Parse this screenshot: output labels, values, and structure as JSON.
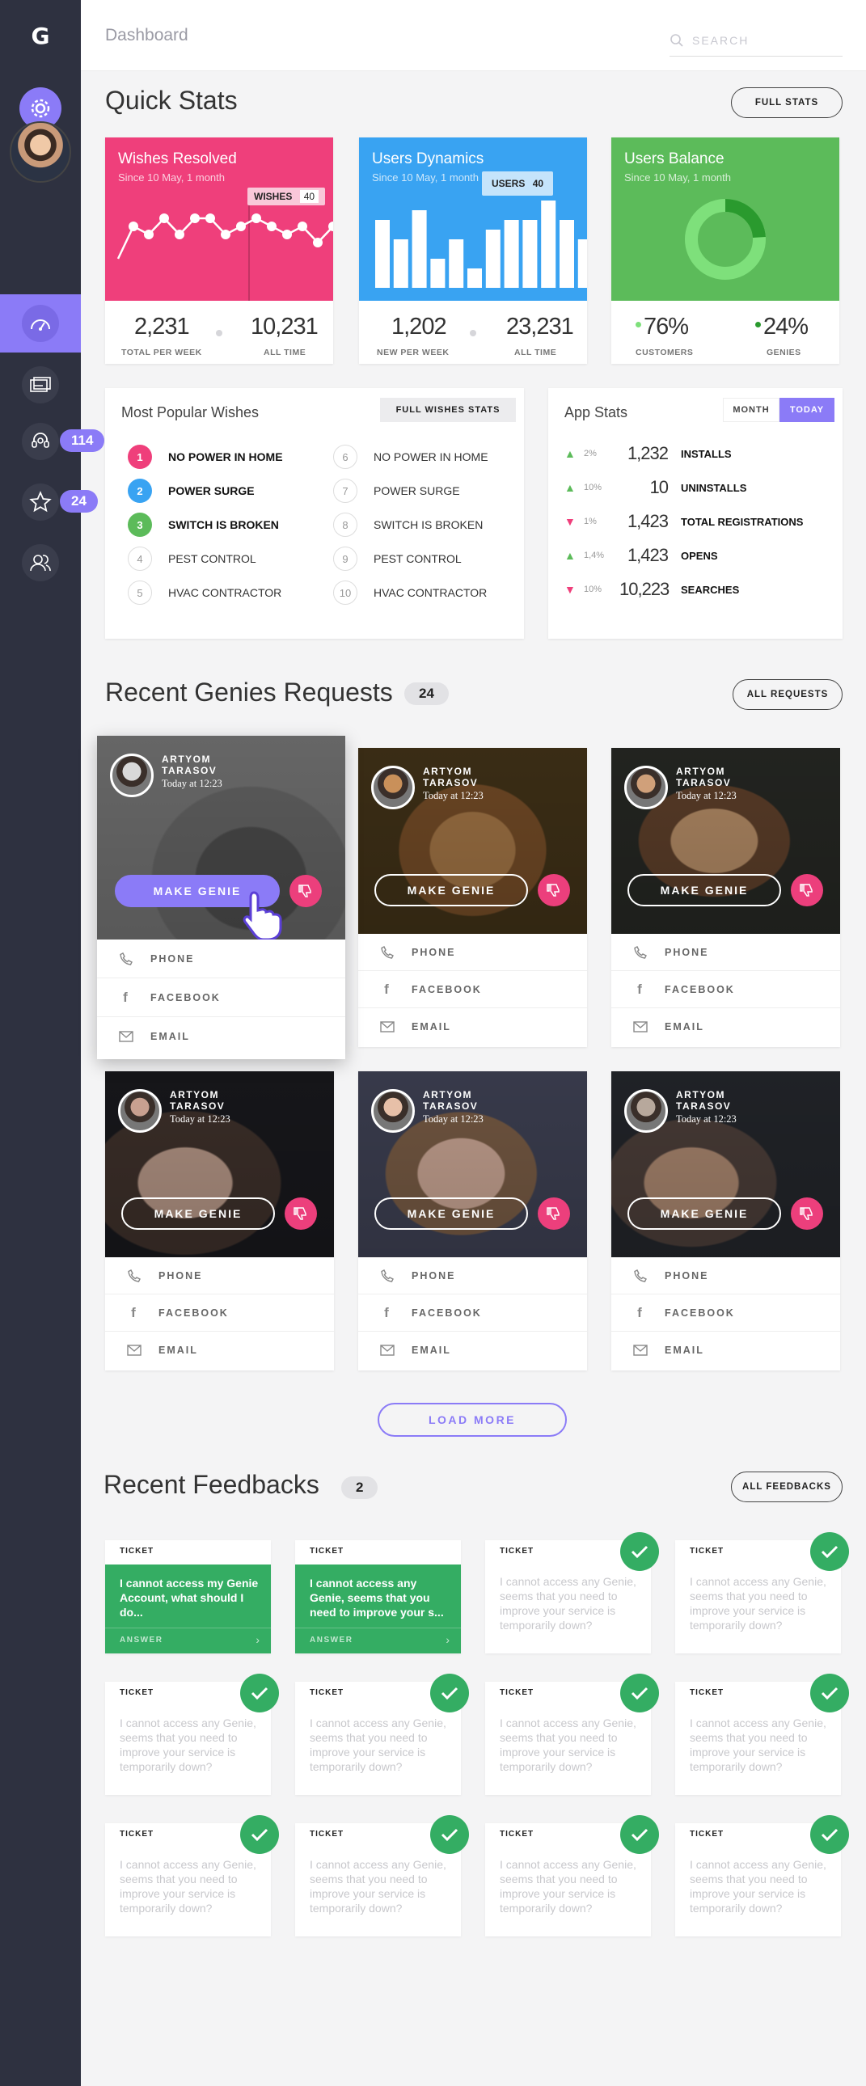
{
  "app": {
    "logo": "G",
    "breadcrumb": "Dashboard"
  },
  "search": {
    "placeholder": "SEARCH"
  },
  "sidebar": {
    "items": [
      {
        "name": "dashboard",
        "icon": "gauge-icon",
        "active": true
      },
      {
        "name": "cards",
        "icon": "cards-icon"
      },
      {
        "name": "support",
        "icon": "headset-icon",
        "badge": "114"
      },
      {
        "name": "favorites",
        "icon": "star-icon",
        "badge": "24"
      },
      {
        "name": "users",
        "icon": "users-icon"
      }
    ]
  },
  "quick_stats": {
    "title": "Quick Stats",
    "full_stats_label": "FULL STATS",
    "cards": [
      {
        "title": "Wishes Resolved",
        "subtitle": "Since 10 May, 1 month",
        "color": "#ef3f7b",
        "tooltip_label": "WISHES",
        "tooltip_value": "40",
        "v1": "2,231",
        "l1": "TOTAL PER WEEK",
        "v2": "10,231",
        "l2": "ALL TIME"
      },
      {
        "title": "Users Dynamics",
        "subtitle": "Since 10 May, 1 month",
        "color": "#39a3f2",
        "tooltip_label": "USERS",
        "tooltip_value": "40",
        "v1": "1,202",
        "l1": "NEW PER WEEK",
        "v2": "23,231",
        "l2": "ALL TIME"
      },
      {
        "title": "Users Balance",
        "subtitle": "Since 10 May, 1 month",
        "color": "#5cbb5a",
        "v1": "76%",
        "l1": "CUSTOMERS",
        "v2": "24%",
        "l2": "GENIES"
      }
    ]
  },
  "chart_data": [
    {
      "type": "line",
      "values": [
        2,
        6,
        5,
        7,
        5,
        7,
        7,
        5,
        6,
        7,
        6,
        5,
        6,
        4,
        6
      ],
      "tooltip": "WISHES 40"
    },
    {
      "type": "bar",
      "values": [
        7,
        5,
        8,
        3,
        5,
        2,
        6,
        7,
        7,
        9,
        7,
        5
      ],
      "tooltip": "USERS 40"
    },
    {
      "type": "pie",
      "slices": [
        {
          "name": "CUSTOMERS",
          "value": 76
        },
        {
          "name": "GENIES",
          "value": 24
        }
      ]
    }
  ],
  "popular_wishes": {
    "title": "Most Popular Wishes",
    "button": "FULL WISHES STATS",
    "left": [
      {
        "n": "1",
        "label": "NO POWER IN HOME",
        "color": "#ef3f7b"
      },
      {
        "n": "2",
        "label": "POWER SURGE",
        "color": "#39a3f2"
      },
      {
        "n": "3",
        "label": "SWITCH IS BROKEN",
        "color": "#5cbb5a"
      },
      {
        "n": "4",
        "label": "PEST CONTROL"
      },
      {
        "n": "5",
        "label": "HVAC CONTRACTOR"
      }
    ],
    "right": [
      {
        "n": "6",
        "label": "NO POWER IN HOME"
      },
      {
        "n": "7",
        "label": "POWER SURGE"
      },
      {
        "n": "8",
        "label": "SWITCH IS BROKEN"
      },
      {
        "n": "9",
        "label": "PEST CONTROL"
      },
      {
        "n": "10",
        "label": "HVAC CONTRACTOR"
      }
    ]
  },
  "app_stats": {
    "title": "App Stats",
    "tab_month": "MONTH",
    "tab_today": "TODAY",
    "rows": [
      {
        "trend": "up",
        "pct": "2%",
        "value": "1,232",
        "label": "INSTALLS"
      },
      {
        "trend": "up",
        "pct": "10%",
        "value": "10",
        "label": "UNINSTALLS"
      },
      {
        "trend": "down",
        "pct": "1%",
        "value": "1,423",
        "label": "TOTAL REGISTRATIONS"
      },
      {
        "trend": "up",
        "pct": "1,4%",
        "value": "1,423",
        "label": "OPENS"
      },
      {
        "trend": "down",
        "pct": "10%",
        "value": "10,223",
        "label": "SEARCHES"
      }
    ]
  },
  "requests": {
    "title": "Recent Genies Requests",
    "count": "24",
    "all_label": "ALL REQUESTS",
    "make_label": "MAKE GENIE",
    "phone_label": "PHONE",
    "facebook_label": "FACEBOOK",
    "email_label": "EMAIL",
    "cards": [
      {
        "name": "ARTYOM TARASOV",
        "time": "Today at 12:23"
      },
      {
        "name": "ARTYOM TARASOV",
        "time": "Today at 12:23"
      },
      {
        "name": "ARTYOM TARASOV",
        "time": "Today at 12:23"
      },
      {
        "name": "ARTYOM TARASOV",
        "time": "Today at 12:23"
      },
      {
        "name": "ARTYOM TARASOV",
        "time": "Today at 12:23"
      },
      {
        "name": "ARTYOM TARASOV",
        "time": "Today at 12:23"
      }
    ],
    "load_more": "LOAD MORE"
  },
  "feedbacks": {
    "title": "Recent Feedbacks",
    "count": "2",
    "all_label": "ALL FEEDBACKS",
    "ticket_label": "TICKET",
    "answer_label": "ANSWER",
    "items": [
      {
        "text": "I cannot access my Genie Account, what should I do...",
        "open": true
      },
      {
        "text": "I cannot access any Genie, seems that you need to improve your s...",
        "open": true
      },
      {
        "text": "I cannot access any Genie, seems that you need to improve your service is temporarily down?"
      },
      {
        "text": "I cannot access any Genie, seems that you need to improve your service is temporarily down?"
      },
      {
        "text": "I cannot access any Genie, seems that you need to improve your service is temporarily down?"
      },
      {
        "text": "I cannot access any Genie, seems that you need to improve your service is temporarily down?"
      },
      {
        "text": "I cannot access any Genie, seems that you need to improve your service is temporarily down?"
      },
      {
        "text": "I cannot access any Genie, seems that you need to improve your service is temporarily down?"
      },
      {
        "text": "I cannot access any Genie, seems that you need to improve your service is temporarily down?"
      },
      {
        "text": "I cannot access any Genie, seems that you need to improve your service is temporarily down?"
      },
      {
        "text": "I cannot access any Genie, seems that you need to improve your service is temporarily down?"
      },
      {
        "text": "I cannot access any Genie, seems that you need to improve your service is temporarily down?"
      }
    ]
  },
  "colors": {
    "accent": "#8b7bf7",
    "pink": "#ef3f7b",
    "blue": "#39a3f2",
    "green": "#5cbb5a",
    "ok": "#34ad63",
    "sidebar": "#2e3140"
  }
}
